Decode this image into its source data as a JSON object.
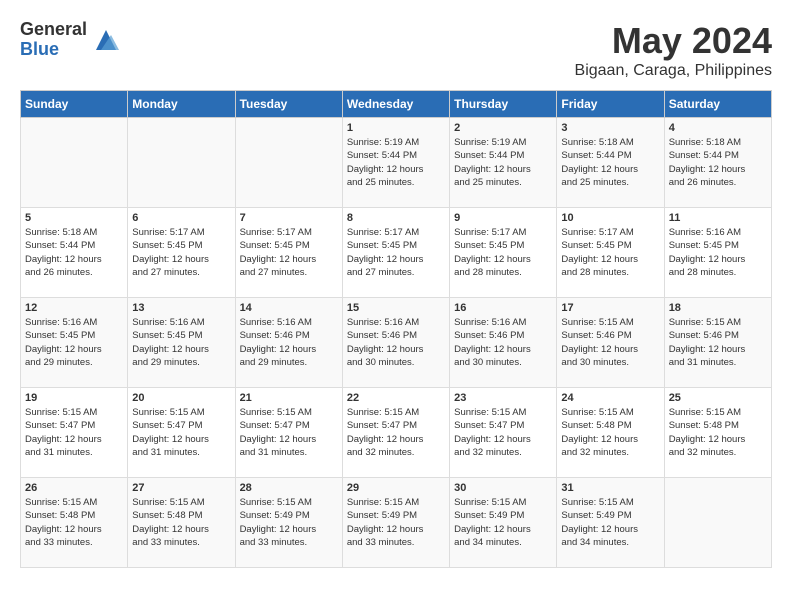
{
  "logo": {
    "general": "General",
    "blue": "Blue"
  },
  "title": "May 2024",
  "subtitle": "Bigaan, Caraga, Philippines",
  "days": [
    "Sunday",
    "Monday",
    "Tuesday",
    "Wednesday",
    "Thursday",
    "Friday",
    "Saturday"
  ],
  "weeks": [
    [
      {
        "num": "",
        "content": ""
      },
      {
        "num": "",
        "content": ""
      },
      {
        "num": "",
        "content": ""
      },
      {
        "num": "1",
        "content": "Sunrise: 5:19 AM\nSunset: 5:44 PM\nDaylight: 12 hours\nand 25 minutes."
      },
      {
        "num": "2",
        "content": "Sunrise: 5:19 AM\nSunset: 5:44 PM\nDaylight: 12 hours\nand 25 minutes."
      },
      {
        "num": "3",
        "content": "Sunrise: 5:18 AM\nSunset: 5:44 PM\nDaylight: 12 hours\nand 25 minutes."
      },
      {
        "num": "4",
        "content": "Sunrise: 5:18 AM\nSunset: 5:44 PM\nDaylight: 12 hours\nand 26 minutes."
      }
    ],
    [
      {
        "num": "5",
        "content": "Sunrise: 5:18 AM\nSunset: 5:44 PM\nDaylight: 12 hours\nand 26 minutes."
      },
      {
        "num": "6",
        "content": "Sunrise: 5:17 AM\nSunset: 5:45 PM\nDaylight: 12 hours\nand 27 minutes."
      },
      {
        "num": "7",
        "content": "Sunrise: 5:17 AM\nSunset: 5:45 PM\nDaylight: 12 hours\nand 27 minutes."
      },
      {
        "num": "8",
        "content": "Sunrise: 5:17 AM\nSunset: 5:45 PM\nDaylight: 12 hours\nand 27 minutes."
      },
      {
        "num": "9",
        "content": "Sunrise: 5:17 AM\nSunset: 5:45 PM\nDaylight: 12 hours\nand 28 minutes."
      },
      {
        "num": "10",
        "content": "Sunrise: 5:17 AM\nSunset: 5:45 PM\nDaylight: 12 hours\nand 28 minutes."
      },
      {
        "num": "11",
        "content": "Sunrise: 5:16 AM\nSunset: 5:45 PM\nDaylight: 12 hours\nand 28 minutes."
      }
    ],
    [
      {
        "num": "12",
        "content": "Sunrise: 5:16 AM\nSunset: 5:45 PM\nDaylight: 12 hours\nand 29 minutes."
      },
      {
        "num": "13",
        "content": "Sunrise: 5:16 AM\nSunset: 5:45 PM\nDaylight: 12 hours\nand 29 minutes."
      },
      {
        "num": "14",
        "content": "Sunrise: 5:16 AM\nSunset: 5:46 PM\nDaylight: 12 hours\nand 29 minutes."
      },
      {
        "num": "15",
        "content": "Sunrise: 5:16 AM\nSunset: 5:46 PM\nDaylight: 12 hours\nand 30 minutes."
      },
      {
        "num": "16",
        "content": "Sunrise: 5:16 AM\nSunset: 5:46 PM\nDaylight: 12 hours\nand 30 minutes."
      },
      {
        "num": "17",
        "content": "Sunrise: 5:15 AM\nSunset: 5:46 PM\nDaylight: 12 hours\nand 30 minutes."
      },
      {
        "num": "18",
        "content": "Sunrise: 5:15 AM\nSunset: 5:46 PM\nDaylight: 12 hours\nand 31 minutes."
      }
    ],
    [
      {
        "num": "19",
        "content": "Sunrise: 5:15 AM\nSunset: 5:47 PM\nDaylight: 12 hours\nand 31 minutes."
      },
      {
        "num": "20",
        "content": "Sunrise: 5:15 AM\nSunset: 5:47 PM\nDaylight: 12 hours\nand 31 minutes."
      },
      {
        "num": "21",
        "content": "Sunrise: 5:15 AM\nSunset: 5:47 PM\nDaylight: 12 hours\nand 31 minutes."
      },
      {
        "num": "22",
        "content": "Sunrise: 5:15 AM\nSunset: 5:47 PM\nDaylight: 12 hours\nand 32 minutes."
      },
      {
        "num": "23",
        "content": "Sunrise: 5:15 AM\nSunset: 5:47 PM\nDaylight: 12 hours\nand 32 minutes."
      },
      {
        "num": "24",
        "content": "Sunrise: 5:15 AM\nSunset: 5:48 PM\nDaylight: 12 hours\nand 32 minutes."
      },
      {
        "num": "25",
        "content": "Sunrise: 5:15 AM\nSunset: 5:48 PM\nDaylight: 12 hours\nand 32 minutes."
      }
    ],
    [
      {
        "num": "26",
        "content": "Sunrise: 5:15 AM\nSunset: 5:48 PM\nDaylight: 12 hours\nand 33 minutes."
      },
      {
        "num": "27",
        "content": "Sunrise: 5:15 AM\nSunset: 5:48 PM\nDaylight: 12 hours\nand 33 minutes."
      },
      {
        "num": "28",
        "content": "Sunrise: 5:15 AM\nSunset: 5:49 PM\nDaylight: 12 hours\nand 33 minutes."
      },
      {
        "num": "29",
        "content": "Sunrise: 5:15 AM\nSunset: 5:49 PM\nDaylight: 12 hours\nand 33 minutes."
      },
      {
        "num": "30",
        "content": "Sunrise: 5:15 AM\nSunset: 5:49 PM\nDaylight: 12 hours\nand 34 minutes."
      },
      {
        "num": "31",
        "content": "Sunrise: 5:15 AM\nSunset: 5:49 PM\nDaylight: 12 hours\nand 34 minutes."
      },
      {
        "num": "",
        "content": ""
      }
    ]
  ]
}
